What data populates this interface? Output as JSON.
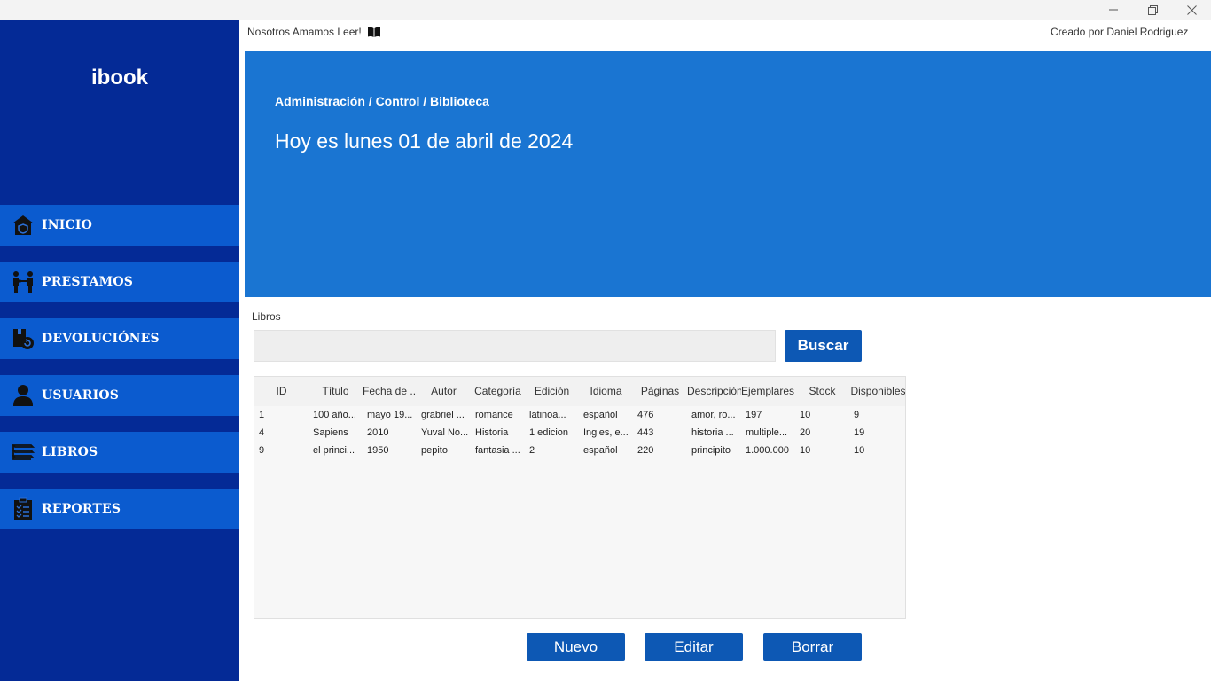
{
  "window": {
    "minimize_glyph": "—",
    "restore_glyph": "❐",
    "close_glyph": "✕"
  },
  "sidebar": {
    "logo": "ibook",
    "items": [
      {
        "label": "INICIO",
        "icon": "home-icon"
      },
      {
        "label": "PRESTAMOS",
        "icon": "people-exchange-icon"
      },
      {
        "label": "DEVOLUCIÓNES",
        "icon": "return-box-icon"
      },
      {
        "label": "USUARIOS",
        "icon": "user-icon"
      },
      {
        "label": "LIBROS",
        "icon": "books-stack-icon"
      },
      {
        "label": "REPORTES",
        "icon": "clipboard-list-icon"
      }
    ]
  },
  "header": {
    "tagline": "Nosotros Amamos Leer!",
    "tagline_icon": "open-book-icon",
    "credits": "Creado por Daniel Rodriguez"
  },
  "banner": {
    "breadcrumb": "Administración / Control / Biblioteca",
    "today": "Hoy es lunes 01 de abril de 2024"
  },
  "search": {
    "label": "Libros",
    "value": "",
    "button": "Buscar"
  },
  "table": {
    "columns": [
      "ID",
      "Título",
      "Fecha de ...",
      "Autor",
      "Categoría",
      "Edición",
      "Idioma",
      "Páginas",
      "Descripción",
      "EjemplaresI",
      "Stock",
      "Disponibles"
    ],
    "rows": [
      [
        "1",
        "100 año...",
        "mayo 19...",
        "grabriel ...",
        "romance",
        "latinoa...",
        "español",
        "476",
        "amor, ro...",
        "197",
        "10",
        "9"
      ],
      [
        "4",
        "Sapiens",
        "2010",
        "Yuval No...",
        "Historia",
        "1 edicion",
        "Ingles, e...",
        "443",
        "historia ...",
        "multiple...",
        "20",
        "19"
      ],
      [
        "9",
        "el princi...",
        "1950",
        "pepito",
        "fantasia ...",
        "2",
        "español",
        "220",
        "principito",
        "1.000.000",
        "10",
        "10"
      ]
    ]
  },
  "actions": {
    "new": "Nuevo",
    "edit": "Editar",
    "delete": "Borrar"
  },
  "colors": {
    "sidebar": "#042a96",
    "nav_item": "#0b5bcf",
    "banner": "#1a75d2",
    "button": "#0d58b4"
  }
}
